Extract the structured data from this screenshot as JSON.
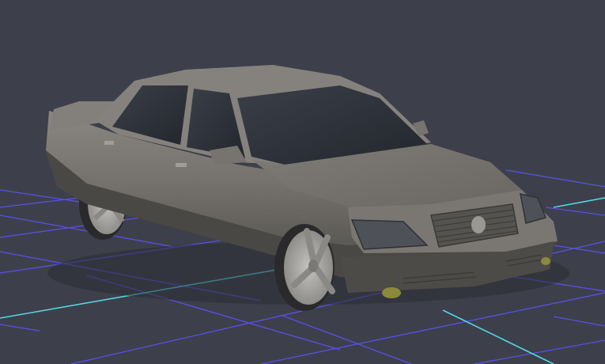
{
  "viewport": {
    "background_color": "#3d3f4b",
    "grid": {
      "visible": true,
      "line_color": "#5b4fe8",
      "x_axis_color": "#4fd8e0",
      "z_axis_color": "#4fd8e0"
    },
    "model": {
      "name": "",
      "body_color": "#77746f",
      "lower_trim_color": "#4a4845",
      "glass_color": "#2e3139",
      "wheel_color": "#b7b5b1",
      "fog_light_color": "#8a8a3a"
    }
  }
}
